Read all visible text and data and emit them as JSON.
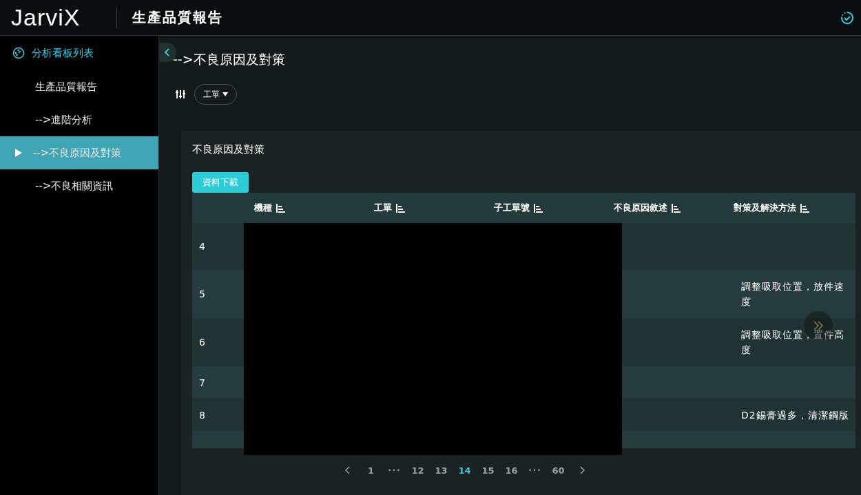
{
  "header": {
    "logo": "JarviX",
    "title": "生產品質報告"
  },
  "sidebar": {
    "heading": "分析看板列表",
    "items": [
      {
        "label": "生產品質報告",
        "selected": false
      },
      {
        "label": "-->進階分析",
        "selected": false
      },
      {
        "label": "-->不良原因及對策",
        "selected": true
      },
      {
        "label": "-->不良相關資訊",
        "selected": false
      }
    ]
  },
  "page": {
    "title": "-->不良原因及對策",
    "filter": {
      "label": "工單"
    }
  },
  "card": {
    "title": "不良原因及對策",
    "download_button": "資料下載",
    "table": {
      "columns": [
        "機種",
        "工單",
        "子工單號",
        "不良原因敘述",
        "對策及解決方法"
      ],
      "rows": [
        {
          "no": "4"
        },
        {
          "no": "5",
          "countermeasure": "調整吸取位置，放件速度"
        },
        {
          "no": "6",
          "countermeasure": "調整吸取位置，置件高度"
        },
        {
          "no": "7"
        },
        {
          "no": "8",
          "countermeasure": "D2錫膏過多，清潔鋼版"
        },
        {}
      ]
    },
    "pagination": [
      {
        "label": "1",
        "selected": false
      },
      {
        "label": "•••",
        "kind": "ellipsis",
        "selected": false
      },
      {
        "label": "12",
        "selected": false
      },
      {
        "label": "13",
        "selected": false
      },
      {
        "label": "14",
        "selected": true
      },
      {
        "label": "15",
        "selected": false
      },
      {
        "label": "16",
        "selected": false
      },
      {
        "label": "•••",
        "kind": "ellipsis",
        "selected": false
      },
      {
        "label": "60",
        "selected": false
      }
    ]
  }
}
